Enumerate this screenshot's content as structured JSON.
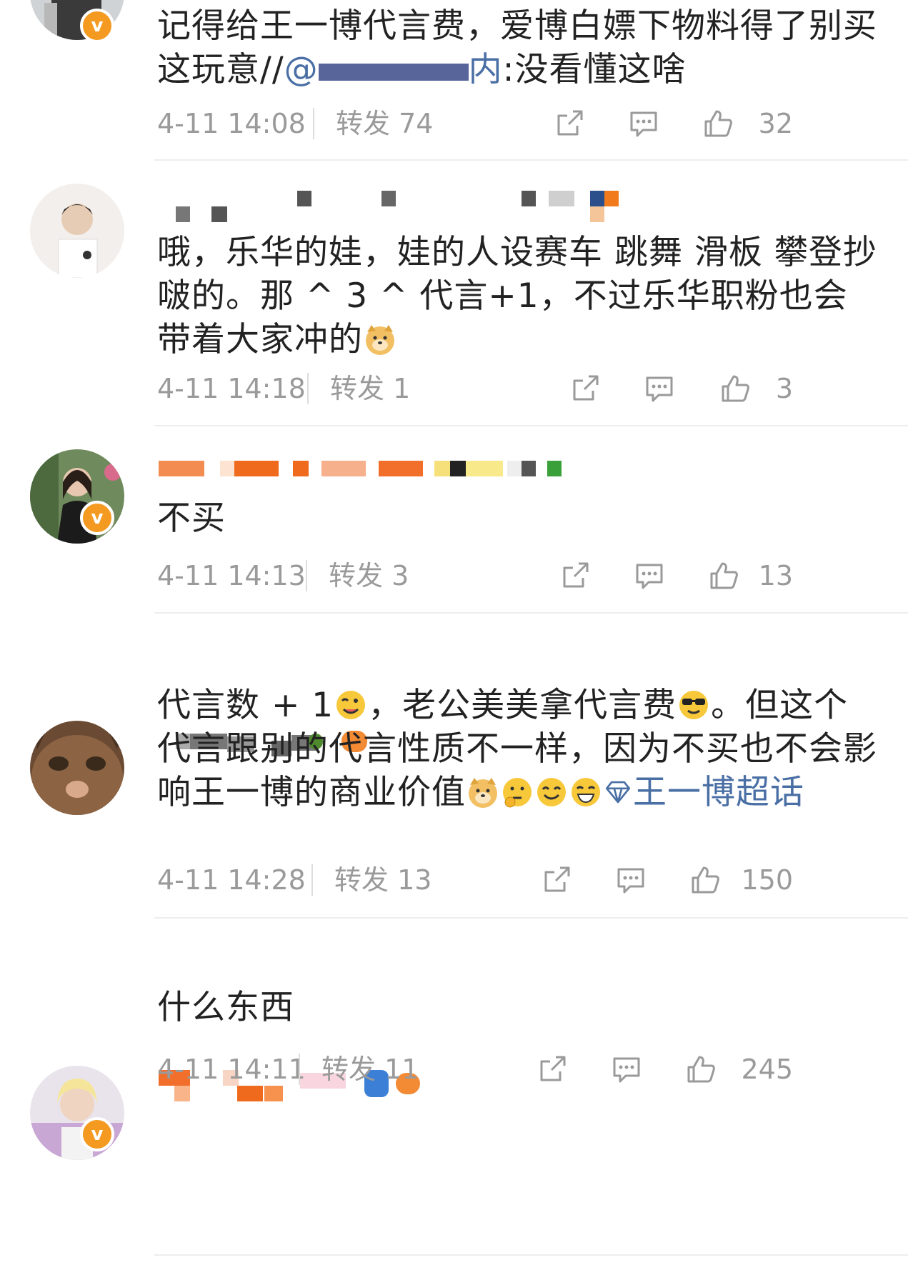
{
  "comments": [
    {
      "text_a": "记得给王一博代言费，爱博白嫖下物料得了别买这玩意//",
      "mention": "@",
      "text_b": "内",
      "text_c": ":没看懂这啥",
      "time": "4-11 14:08",
      "forward": "转发 74",
      "likes": "32",
      "verified": true
    },
    {
      "text_a": "哦，乐华的娃，娃的人设赛车 跳舞 滑板 攀登抄啵的。那 ^ 3 ^ 代言+1，不过乐华职粉也会带着大家冲的",
      "time": "4-11 14:18",
      "forward": "转发 1",
      "likes": "3",
      "verified": false
    },
    {
      "text_a": "不买",
      "time": "4-11 14:13",
      "forward": "转发 3",
      "likes": "13",
      "verified": true
    },
    {
      "text_a": "代言数 + 1",
      "text_b": "，老公美美拿代言费",
      "text_c": "。但这个代言跟别的代言性质不一样，因为不买也不会影响王一博的商业价值",
      "topic": "王一博超话",
      "time": "4-11 14:28",
      "forward": "转发 13",
      "likes": "150",
      "verified": false
    },
    {
      "text_a": "什么东西",
      "time": "4-11 14:11",
      "forward": "转发 11",
      "likes": "245",
      "verified": true
    }
  ],
  "icons": {
    "share": "share-icon",
    "comment": "comment-icon",
    "like": "thumbs-up-icon",
    "verified": "verified-badge-icon",
    "topic": "diamond-topic-icon"
  },
  "colors": {
    "accent_orange": "#f49a20",
    "link_blue": "#4a6fa5",
    "meta_gray": "#9a9a9a"
  }
}
